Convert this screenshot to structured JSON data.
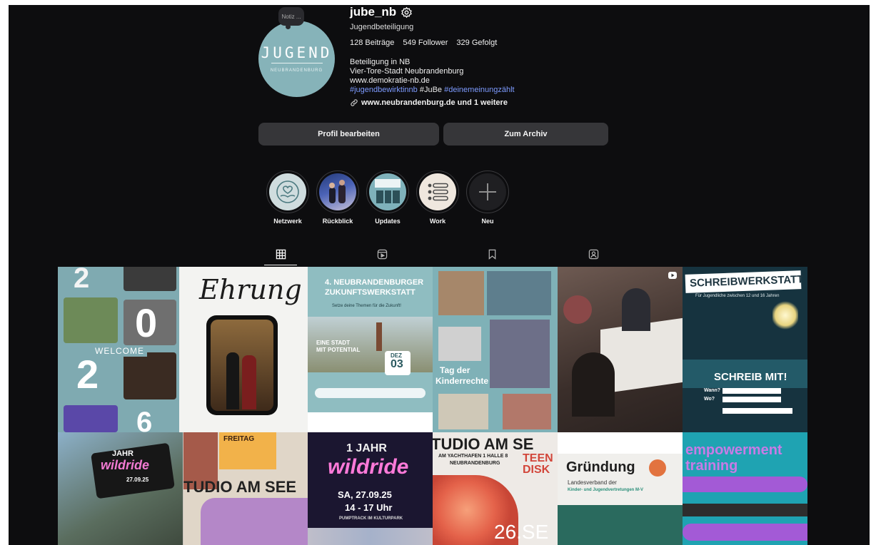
{
  "profile": {
    "note": "Notiz ...",
    "username": "jube_nb",
    "category": "Jugendbeteiligung",
    "stats": {
      "posts": "128",
      "posts_label": "Beiträge",
      "followers": "549",
      "followers_label": "Follower",
      "following": "329",
      "following_label": "Gefolgt"
    },
    "bio": [
      "Beteiligung in NB",
      "Vier-Tore-Stadt Neubrandenburg",
      "www.demokratie-nb.de"
    ],
    "hashtags": [
      "#jugendbewirktinnb",
      "#JuBe",
      "#deinemeinungzählt"
    ],
    "link": "www.neubrandenburg.de und 1 weitere",
    "avatar_text": "JUGEND",
    "avatar_subtext": "NEUBRANDENBURG"
  },
  "buttons": {
    "edit": "Profil bearbeiten",
    "archive": "Zum Archiv"
  },
  "highlights": [
    {
      "label": "Netzwerk",
      "icon": "hands-heart-icon"
    },
    {
      "label": "Rückblick",
      "icon": "photo-thumbnail"
    },
    {
      "label": "Updates",
      "icon": "photo-thumbnail"
    },
    {
      "label": "Work",
      "icon": "list-icon"
    },
    {
      "label": "Neu",
      "icon": "plus-icon"
    }
  ],
  "tabs": [
    "grid-icon",
    "reels-icon",
    "saved-icon",
    "tagged-icon"
  ],
  "posts": [
    {
      "texts": [
        "2",
        "0",
        "2",
        "WELCOME",
        "Ehrung",
        "6"
      ]
    },
    {
      "texts": [
        "4. NEUBRANDENBURGER",
        "ZUKUNFTSWERKSTATT",
        "Setze deine Themen für die Zukunft!",
        "EINE STADT",
        "MIT POTENTIAL",
        "DEZ",
        "03"
      ]
    },
    {
      "texts": [
        "Tag der",
        "Kinderrechte"
      ]
    },
    {
      "texts": []
    },
    {
      "texts": [
        "SCHREIBWERKSTATT",
        "Für Jugendliche zwischen 12 und 16 Jahren",
        "SCHREIB MIT!",
        "Wann?",
        "Wo?"
      ]
    },
    {
      "texts": [
        "JAHR",
        "wildride",
        "FREITAG",
        "TUDIO AM SEE",
        "27.09.25"
      ]
    },
    {
      "texts": [
        "1 JAHR",
        "wildride",
        "SA, 27.09.25",
        "14 - 17 Uhr",
        "PUMPTRACK IM KULTURPARK"
      ]
    },
    {
      "texts": [
        "TUDIO AM SE",
        "AM YACHTHAFEN 1 HALLE 8",
        "NEUBRANDENBURG",
        "TEEN",
        "DISK",
        "26.SE"
      ]
    },
    {
      "texts": [
        "Gründung",
        "Landesverband der",
        "Kinder- und Jugendvertretungen M-V"
      ]
    },
    {
      "texts": [
        "empowerment",
        "training"
      ]
    }
  ]
}
